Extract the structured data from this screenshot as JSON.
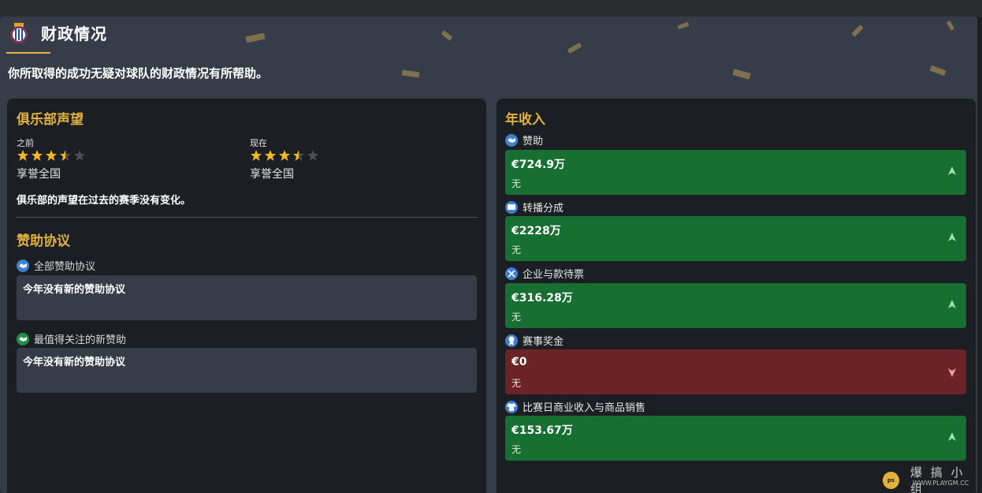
{
  "header": {
    "title": "财政情况",
    "subtitle": "你所取得的成功无疑对球队的财政情况有所帮助。"
  },
  "reputation": {
    "section_title": "俱乐部声望",
    "before_label": "之前",
    "before_stars": 3.5,
    "before_status": "享誉全国",
    "now_label": "现在",
    "now_stars": 3.5,
    "now_status": "享誉全国",
    "description": "俱乐部的声望在过去的赛季没有变化。"
  },
  "sponsorship": {
    "section_title": "赞助协议",
    "all_label": "全部赞助协议",
    "all_message": "今年没有新的赞助协议",
    "notable_label": "最值得关注的新赞助",
    "notable_message": "今年没有新的赞助协议"
  },
  "income": {
    "section_title": "年收入",
    "items": [
      {
        "label": "赞助",
        "value": "€724.9万",
        "change": "无",
        "trend": "up",
        "icon": "handshake-icon"
      },
      {
        "label": "转播分成",
        "value": "€2228万",
        "change": "无",
        "trend": "up",
        "icon": "tv-icon"
      },
      {
        "label": "企业与款待票",
        "value": "€316.28万",
        "change": "无",
        "trend": "up",
        "icon": "cutlery-icon"
      },
      {
        "label": "赛事奖金",
        "value": "€0",
        "change": "无",
        "trend": "down",
        "icon": "medal-icon"
      },
      {
        "label": "比赛日商业收入与商品销售",
        "value": "€153.67万",
        "change": "无",
        "trend": "up",
        "icon": "shirt-icon"
      }
    ]
  },
  "colors": {
    "accent": "#e3b23c",
    "positive": "#176f31",
    "negative": "#6b2326",
    "star": "#f2b81f"
  },
  "watermark": {
    "text": "爆 搞 小 组",
    "url": "WWW.PLAYGM.CC",
    "badge": "ps"
  }
}
